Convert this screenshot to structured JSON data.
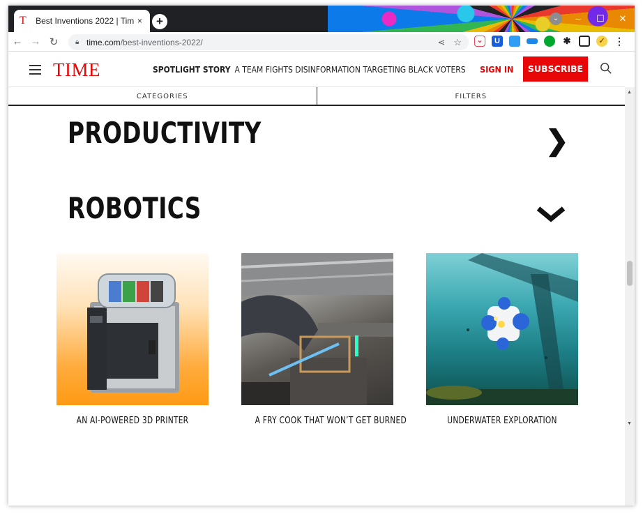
{
  "browser": {
    "tab_title": "Best Inventions 2022 | Tim",
    "tab_close": "×",
    "new_tab": "+",
    "url_host": "time.com",
    "url_path": "/best-inventions-2022/"
  },
  "site": {
    "logo": "TIME",
    "spotlight_label": "SPOTLIGHT STORY",
    "spotlight_text": "A TEAM FIGHTS DISINFORMATION TARGETING BLACK VOTERS",
    "signin": "SIGN IN",
    "subscribe": "SUBSCRIBE"
  },
  "filterbar": {
    "categories": "CATEGORIES",
    "filters": "FILTERS"
  },
  "sections": {
    "productivity": "PRODUCTIVITY",
    "robotics": "ROBOTICS"
  },
  "cards": [
    {
      "caption": "AN AI-POWERED 3D PRINTER"
    },
    {
      "caption": "A FRY COOK THAT WON’T GET BURNED"
    },
    {
      "caption": "UNDERWATER EXPLORATION"
    }
  ],
  "colors": {
    "brand_red": "#e90606",
    "printer_orange": "#ff9a14"
  }
}
